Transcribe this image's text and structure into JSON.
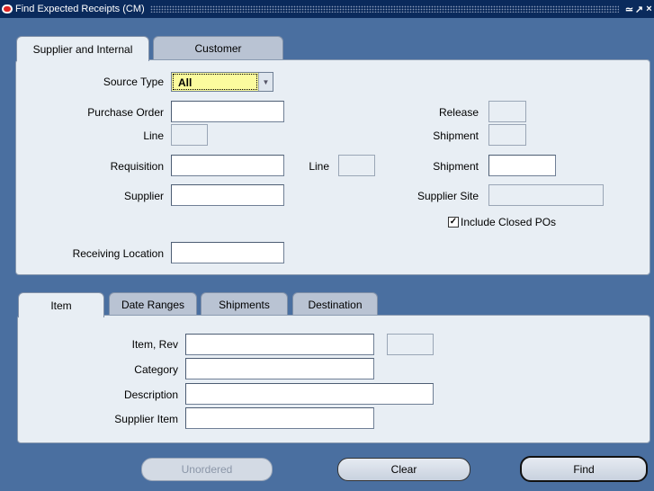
{
  "window": {
    "title": "Find Expected Receipts (CM)"
  },
  "top_tabs": [
    {
      "label": "Supplier and Internal",
      "active": true
    },
    {
      "label": "Customer",
      "active": false
    }
  ],
  "form": {
    "source_type": {
      "label": "Source Type",
      "value": "All"
    },
    "purchase_order": {
      "label": "Purchase Order",
      "value": ""
    },
    "release": {
      "label": "Release",
      "value": ""
    },
    "po_line": {
      "label": "Line",
      "value": ""
    },
    "po_shipment": {
      "label": "Shipment",
      "value": ""
    },
    "requisition": {
      "label": "Requisition",
      "value": ""
    },
    "req_line": {
      "label": "Line",
      "value": ""
    },
    "req_shipment": {
      "label": "Shipment",
      "value": ""
    },
    "supplier": {
      "label": "Supplier",
      "value": ""
    },
    "supplier_site": {
      "label": "Supplier Site",
      "value": ""
    },
    "include_closed": {
      "label": "Include Closed POs",
      "checked": true
    },
    "receiving_location": {
      "label": "Receiving Location",
      "value": ""
    }
  },
  "lower_tabs": [
    {
      "label": "Item",
      "active": true
    },
    {
      "label": "Date Ranges",
      "active": false
    },
    {
      "label": "Shipments",
      "active": false
    },
    {
      "label": "Destination",
      "active": false
    }
  ],
  "item": {
    "item_rev": {
      "label": "Item, Rev",
      "value": "",
      "rev": ""
    },
    "category": {
      "label": "Category",
      "value": ""
    },
    "description": {
      "label": "Description",
      "value": ""
    },
    "supplier_item": {
      "label": "Supplier Item",
      "value": ""
    }
  },
  "buttons": {
    "unordered": "Unordered",
    "clear": "Clear",
    "find": "Find"
  },
  "colors": {
    "titlebar": "#0a2a5c",
    "background": "#4a6fa0",
    "panel": "#e8eef4",
    "combo_highlight": "#fbfb9e"
  }
}
